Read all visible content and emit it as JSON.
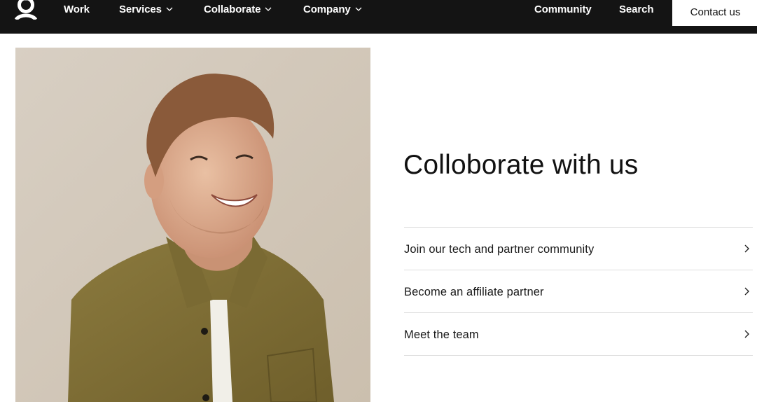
{
  "nav": {
    "logo_icon": "brand-logo-icon",
    "items": [
      {
        "label": "Work",
        "has_dropdown": false
      },
      {
        "label": "Services",
        "has_dropdown": true
      },
      {
        "label": "Collaborate",
        "has_dropdown": true
      },
      {
        "label": "Company",
        "has_dropdown": true
      }
    ],
    "right_items": [
      {
        "label": "Community"
      },
      {
        "label": "Search"
      }
    ],
    "contact_label": "Contact us",
    "background": "#141414"
  },
  "hero": {
    "photo_icon": "portrait-photo",
    "heading": "Colloborate with us",
    "links": [
      {
        "label": "Join our tech and partner community"
      },
      {
        "label": "Become an affiliate partner"
      },
      {
        "label": "Meet the team"
      }
    ]
  }
}
